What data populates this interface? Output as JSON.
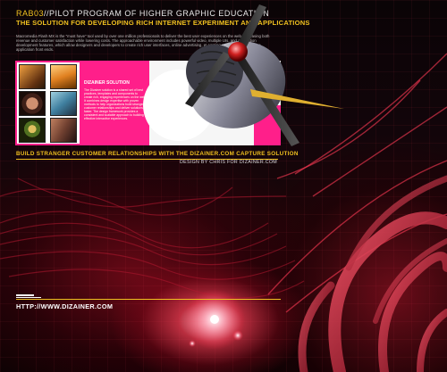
{
  "header": {
    "code": "RAB03",
    "title": "//PILOT PROGRAM OF HIGHER GRAPHIC EDUCATION",
    "subtitle": "THE SOLUTION FOR DEVELOPING RICH INTERNET EXPERIMENT AND APPLICATIONS",
    "body": "Macromedia Flash MX is the \"must have\" tool used by over one million professionals to deliver the best user experiences on the web, increasing both revenue and customer satisfaction while lowering costs. The approachable environment includes powerful video, multiple UIs, and application development features, which allow designers and developers to create rich user interfaces, online advertising, eLearning courses and enterprise application front ends."
  },
  "banner": {
    "mid_title": "DIZAINER SOLUTION",
    "mid_text": "The Dizainer solution is a shared set of best practices, templates and components to create rich, engaging experiences on the web. It combines design expertise with proven methods to help organizations build stranger customer relationships and deliver solutions faster. The design framework provides a consistent and scalable approach to building effective interactive experiences."
  },
  "tagline": "BUILD STRANGER CUSTOMER RELATIONSHIPS WITH THE DIZAINER.COM CAPTURE SOLUTION",
  "credit": "DESIGN BY CHRIS FOR DIZAINER.COM",
  "url": "HTTP://WWW.DIZAINER.COM",
  "colors": {
    "accent": "#f0c020",
    "banner_pink": "#ff1f8a",
    "glow": "#e0304a"
  }
}
